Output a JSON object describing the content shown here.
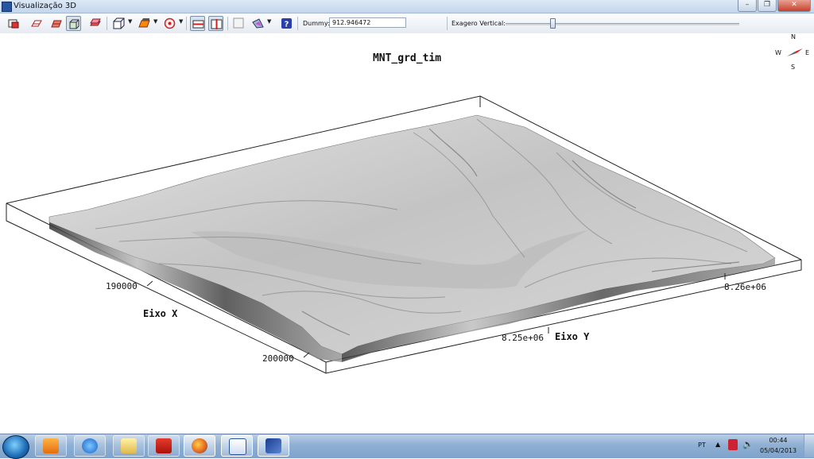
{
  "window": {
    "title": "Visualização 3D"
  },
  "toolbar": {
    "dummy_label": "Dummy:",
    "dummy_value": "912.946472",
    "exaggeration_label": "Exagero Vertical:",
    "exaggeration_level": 0.2,
    "help_label": "?"
  },
  "plot": {
    "title": "MNT_grd_tim",
    "x_axis_title": "Eixo X",
    "x_ticks": [
      "190000",
      "200000"
    ],
    "y_axis_title": "Eixo Y",
    "y_ticks": [
      "8.25e+06",
      "8.26e+06"
    ]
  },
  "compass": {
    "n": "N",
    "s": "S",
    "w": "W",
    "e": "E"
  },
  "taskbar": {
    "apps": [
      "start-orb",
      "media-player",
      "internet-explorer",
      "file-explorer",
      "adobe-reader",
      "firefox",
      "word",
      "surface-app"
    ],
    "language": "PT",
    "time": "00:44",
    "date": "05/04/2013"
  }
}
